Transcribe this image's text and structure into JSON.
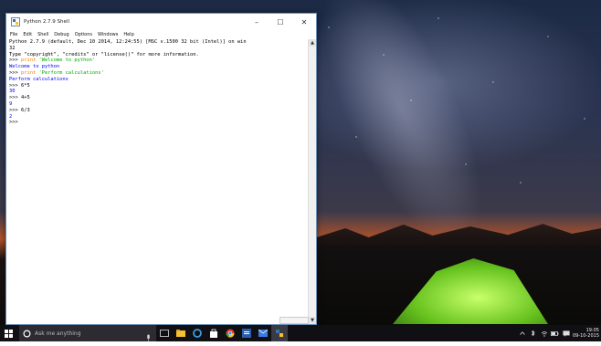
{
  "window": {
    "title": "Python 2.7.9 Shell",
    "menu": [
      "File",
      "Edit",
      "Shell",
      "Debug",
      "Options",
      "Windows",
      "Help"
    ],
    "controls": {
      "minimize": "–",
      "maximize": "☐",
      "close": "✕"
    }
  },
  "shell": {
    "lines": [
      {
        "prompt": "",
        "kw": "",
        "text": "Python 2.7.9 (default, Dec 10 2014, 12:24:55) [MSC v.1500 32 bit (Intel)] on win",
        "type": "plain"
      },
      {
        "prompt": "",
        "kw": "",
        "text": "32",
        "type": "plain"
      },
      {
        "prompt": "",
        "kw": "",
        "text": "Type \"copyright\", \"credits\" or \"license()\" for more information.",
        "type": "plain"
      },
      {
        "prompt": ">>> ",
        "kw": "print ",
        "text": "'Welcome to python'",
        "type": "input-str"
      },
      {
        "prompt": "",
        "kw": "",
        "text": "Welcome to python",
        "type": "output"
      },
      {
        "prompt": ">>> ",
        "kw": "print ",
        "text": "'Perform calculations'",
        "type": "input-str"
      },
      {
        "prompt": "",
        "kw": "",
        "text": "Perform calculations",
        "type": "output"
      },
      {
        "prompt": ">>> ",
        "kw": "",
        "text": "6*5",
        "type": "input"
      },
      {
        "prompt": "",
        "kw": "",
        "text": "30",
        "type": "output"
      },
      {
        "prompt": ">>> ",
        "kw": "",
        "text": "4+5",
        "type": "input"
      },
      {
        "prompt": "",
        "kw": "",
        "text": "9",
        "type": "output"
      },
      {
        "prompt": ">>> ",
        "kw": "",
        "text": "6/3",
        "type": "input"
      },
      {
        "prompt": "",
        "kw": "",
        "text": "2",
        "type": "output"
      },
      {
        "prompt": ">>> ",
        "kw": "",
        "text": "",
        "type": "input"
      }
    ]
  },
  "taskbar": {
    "search_placeholder": "Ask me anything",
    "time": "19:05",
    "date": "09-10-2015"
  },
  "colors": {
    "keyword": "#ff7700",
    "string": "#00aa00",
    "output": "#0000ff",
    "taskbar": "#101014"
  }
}
